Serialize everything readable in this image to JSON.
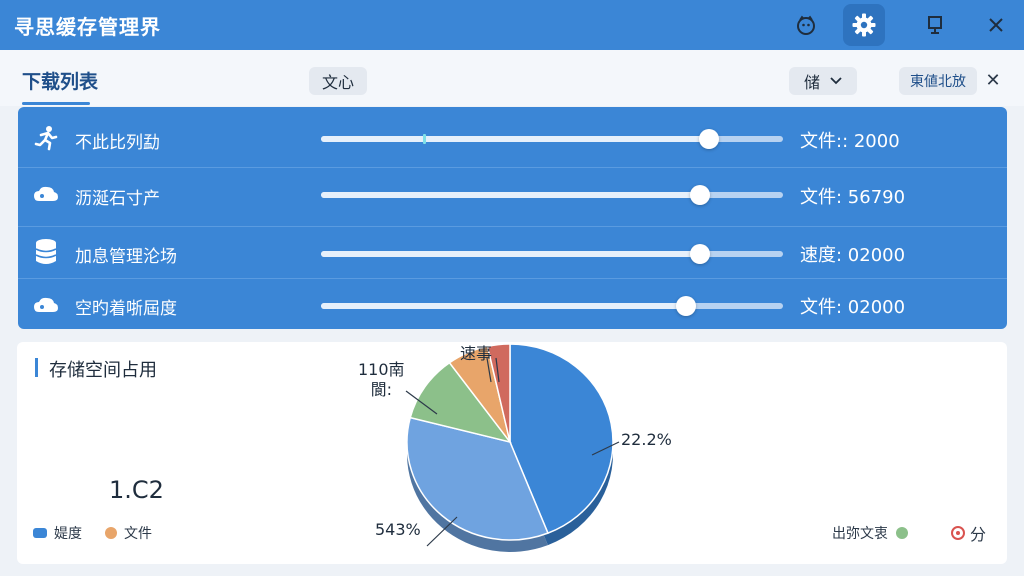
{
  "app": {
    "title": "寻思缓存管理界"
  },
  "toolbar": {
    "list_title": "下载列表",
    "center_pill": "文心",
    "sort_pill": "储",
    "right_pill": "東値北放",
    "close_label": "✕"
  },
  "downloads": [
    {
      "name": "不此比列勐",
      "value_label": "文件:: 2000",
      "icon": "runner-icon",
      "progress": 0.84,
      "marker": 0.22
    },
    {
      "name": "沥涎石寸产",
      "value_label": "文件: 56790",
      "icon": "cloud-icon",
      "progress": 0.82
    },
    {
      "name": "加息管理沦场",
      "value_label": "速度: 02000",
      "icon": "database-icon",
      "progress": 0.82
    },
    {
      "name": "空旳着哳屆度",
      "value_label": "文件: 02000",
      "icon": "cloud-icon",
      "progress": 0.79
    }
  ],
  "storage": {
    "title": "存储空间占用",
    "big_number": "1.C2",
    "legend_left": [
      {
        "label": "媞度",
        "color": "#3b86d6"
      },
      {
        "label": "文件",
        "color": "#e8a56a"
      }
    ],
    "legend_right": [
      {
        "label": "出弥文衷",
        "color": "#8cc08a"
      },
      {
        "label": "分",
        "color": "#d9534f"
      }
    ]
  },
  "chart_data": {
    "type": "pie",
    "slices": [
      {
        "value": 44.0,
        "color": "#3b86d6"
      },
      {
        "value": 35.0,
        "color": "#6fa3e0"
      },
      {
        "value": 11.0,
        "color": "#8cc08a"
      },
      {
        "value": 6.5,
        "color": "#e8a56a"
      },
      {
        "value": 3.5,
        "color": "#d06a5e"
      }
    ],
    "labels": [
      "22.2%",
      "543%",
      "110南\n閬:",
      "速事"
    ]
  }
}
